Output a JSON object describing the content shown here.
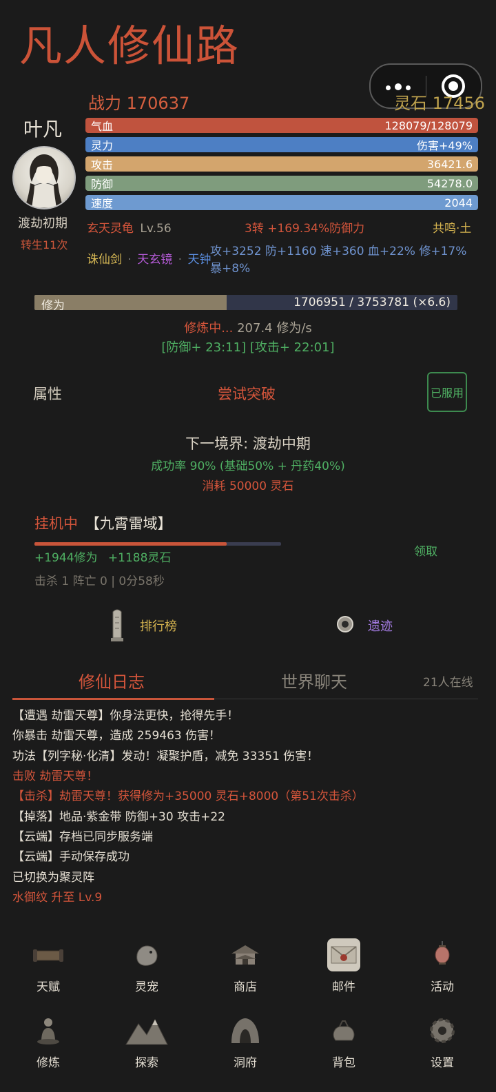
{
  "app_title": "凡人修仙路",
  "header": {
    "power": "战力 170637",
    "spirit_stone": "灵石 17456"
  },
  "character": {
    "name": "叶凡",
    "realm": "渡劫初期",
    "rebirth": "转生11次"
  },
  "stats": [
    {
      "label": "气血",
      "value": "128079/128079",
      "color": "#c0533e"
    },
    {
      "label": "灵力",
      "value": "伤害+49%",
      "color": "#4d7fc4"
    },
    {
      "label": "攻击",
      "value": "36421.6",
      "color": "#d3a56d"
    },
    {
      "label": "防御",
      "value": "54278.0",
      "color": "#7f9c7d"
    },
    {
      "label": "速度",
      "value": "2044",
      "color": "#6e9ad0"
    }
  ],
  "pet": {
    "name": "玄天灵龟",
    "level": "Lv.56",
    "turn": "3转 +169.34%防御力",
    "resonance": "共鸣·土"
  },
  "artifacts": {
    "a1": "诛仙剑",
    "dot1": "·",
    "a2": "天玄镜",
    "dot2": "·",
    "a3": "天钟",
    "bonus_line1": "攻+3252 防+1160 速+360 血+22% 修+17%",
    "bonus_line2": "暴+8%"
  },
  "cultivation": {
    "label": "修为",
    "value": "1706951 / 3753781 (×6.6)",
    "progress": 0.4547,
    "status_prefix": "修炼中...",
    "rate": " 207.4 修为/s",
    "buffs": "[防御+ 23:11] [攻击+ 22:01]"
  },
  "breakthrough": {
    "tab_attr": "属性",
    "try_label": "尝试突破",
    "pill_button": "已服用",
    "next_realm": "下一境界: 渡劫中期",
    "success_rate": "成功率 90% (基础50% + 丹药40%)",
    "cost": "消耗 50000 灵石"
  },
  "idle": {
    "status": "挂机中",
    "location": "【九霄雷域】",
    "progress": 0.78,
    "gain_cultivation": "+1944修为",
    "gain_stone": "+1188灵石",
    "claim": "领取",
    "stats": "击杀 1 阵亡 0 | 0分58秒"
  },
  "shortcuts": {
    "ranking": "排行榜",
    "ruins": "遗迹"
  },
  "tabs": {
    "log": "修仙日志",
    "chat": "世界聊天",
    "online": "21人在线"
  },
  "log_lines": [
    {
      "text": "【遭遇 劫雷天尊】你身法更快，抢得先手！",
      "color": "#e4ded2"
    },
    {
      "text": "你暴击 劫雷天尊，造成 259463 伤害！",
      "color": "#e4ded2"
    },
    {
      "text": "功法【列字秘·化清】发动！凝聚护盾，减免 33351 伤害！",
      "color": "#e4ded2"
    },
    {
      "text": "击败 劫雷天尊！",
      "color": "#d4553b"
    },
    {
      "text": "【击杀】劫雷天尊！获得修为+35000 灵石+8000（第51次击杀）",
      "color": "#d4553b"
    },
    {
      "text": "【掉落】地品·紫金带 防御+30 攻击+22",
      "color": "#e4ded2"
    },
    {
      "text": "【云端】存档已同步服务端",
      "color": "#e4ded2"
    },
    {
      "text": "【云端】手动保存成功",
      "color": "#e4ded2"
    },
    {
      "text": "已切换为聚灵阵",
      "color": "#e4ded2"
    },
    {
      "text": "水御纹 升至 Lv.9",
      "color": "#d4553b"
    }
  ],
  "nav_row1": [
    "天赋",
    "灵宠",
    "商店",
    "邮件",
    "活动"
  ],
  "nav_row2": [
    "修炼",
    "探索",
    "洞府",
    "背包",
    "设置"
  ]
}
